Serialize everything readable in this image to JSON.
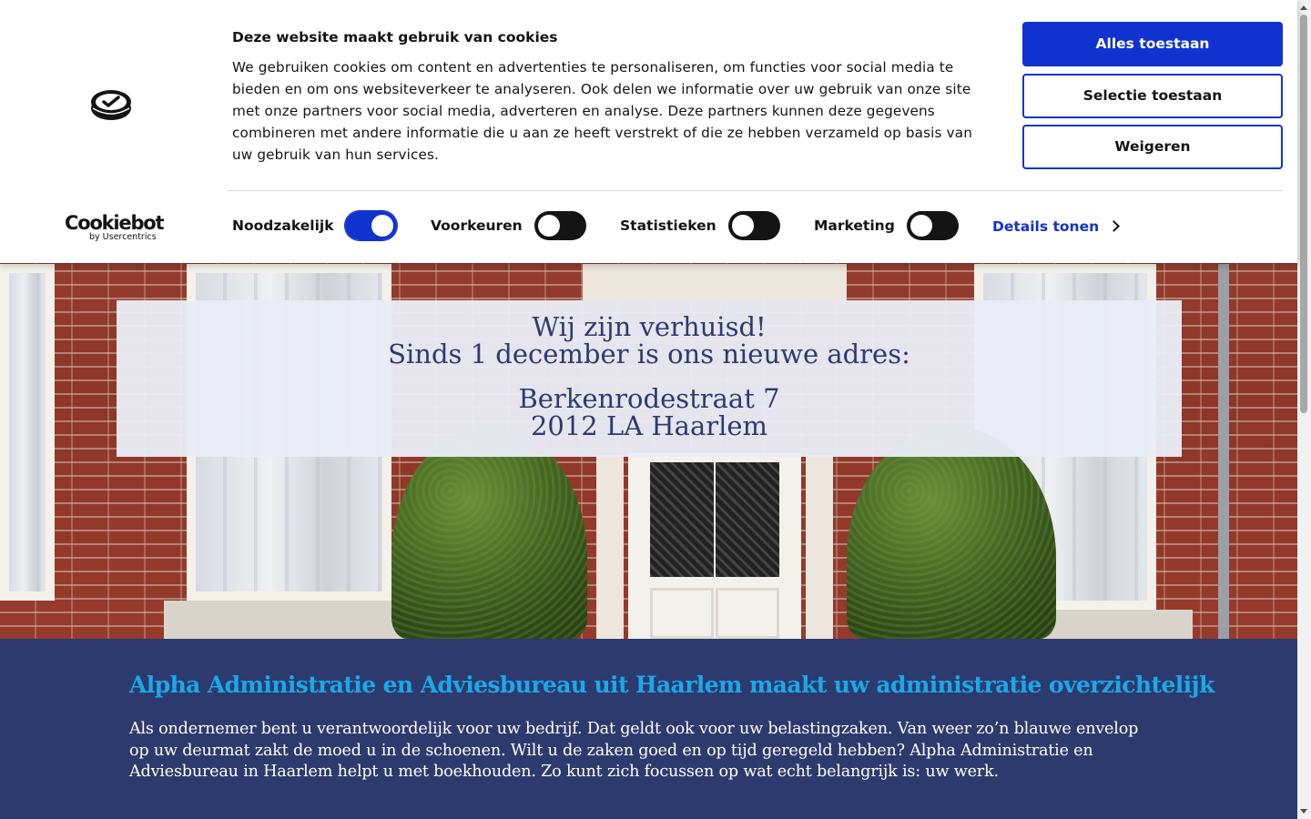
{
  "cookie_banner": {
    "title": "Deze website maakt gebruik van cookies",
    "body": "We gebruiken cookies om content en advertenties te personaliseren, om functies voor social media te bieden en om ons websiteverkeer te analyseren. Ook delen we informatie over uw gebruik van onze site met onze partners voor social media, adverteren en analyse. Deze partners kunnen deze gegevens combineren met andere informatie die u aan ze heeft verstrekt of die ze hebben verzameld op basis van uw gebruik van hun services.",
    "buttons": {
      "allow_all": "Alles toestaan",
      "allow_selection": "Selectie toestaan",
      "deny": "Weigeren"
    },
    "toggles": [
      {
        "label": "Noodzakelijk",
        "checked": true
      },
      {
        "label": "Voorkeuren",
        "checked": false
      },
      {
        "label": "Statistieken",
        "checked": false
      },
      {
        "label": "Marketing",
        "checked": false
      }
    ],
    "details_link": "Details tonen",
    "logo": {
      "name": "Cookiebot",
      "by": "by Usercentrics"
    },
    "accent_color": "#1032cf"
  },
  "hero_notice": {
    "line1": "Wij zijn verhuisd!",
    "line2": "Sinds 1 december is ons nieuwe adres:",
    "street": "Berkenrodestraat 7",
    "city": "2012 LA Haarlem"
  },
  "content": {
    "heading": "Alpha Administratie en Adviesbureau uit Haarlem maakt uw administratie overzichtelijk",
    "paragraph": "Als ondernemer bent u verantwoordelijk voor uw bedrijf. Dat geldt ook voor uw belastingzaken. Van weer zo’n blauwe envelop op uw deurmat zakt de moed u in de schoenen. Wilt u de zaken goed en op tijd geregeld hebben? Alpha Administratie en Adviesbureau in Haarlem helpt u met boekhouden. Zo kunt zich focussen op wat echt belangrijk is: uw werk.",
    "heading_color": "#1aa8e8",
    "background_color": "#2d3a6e"
  }
}
